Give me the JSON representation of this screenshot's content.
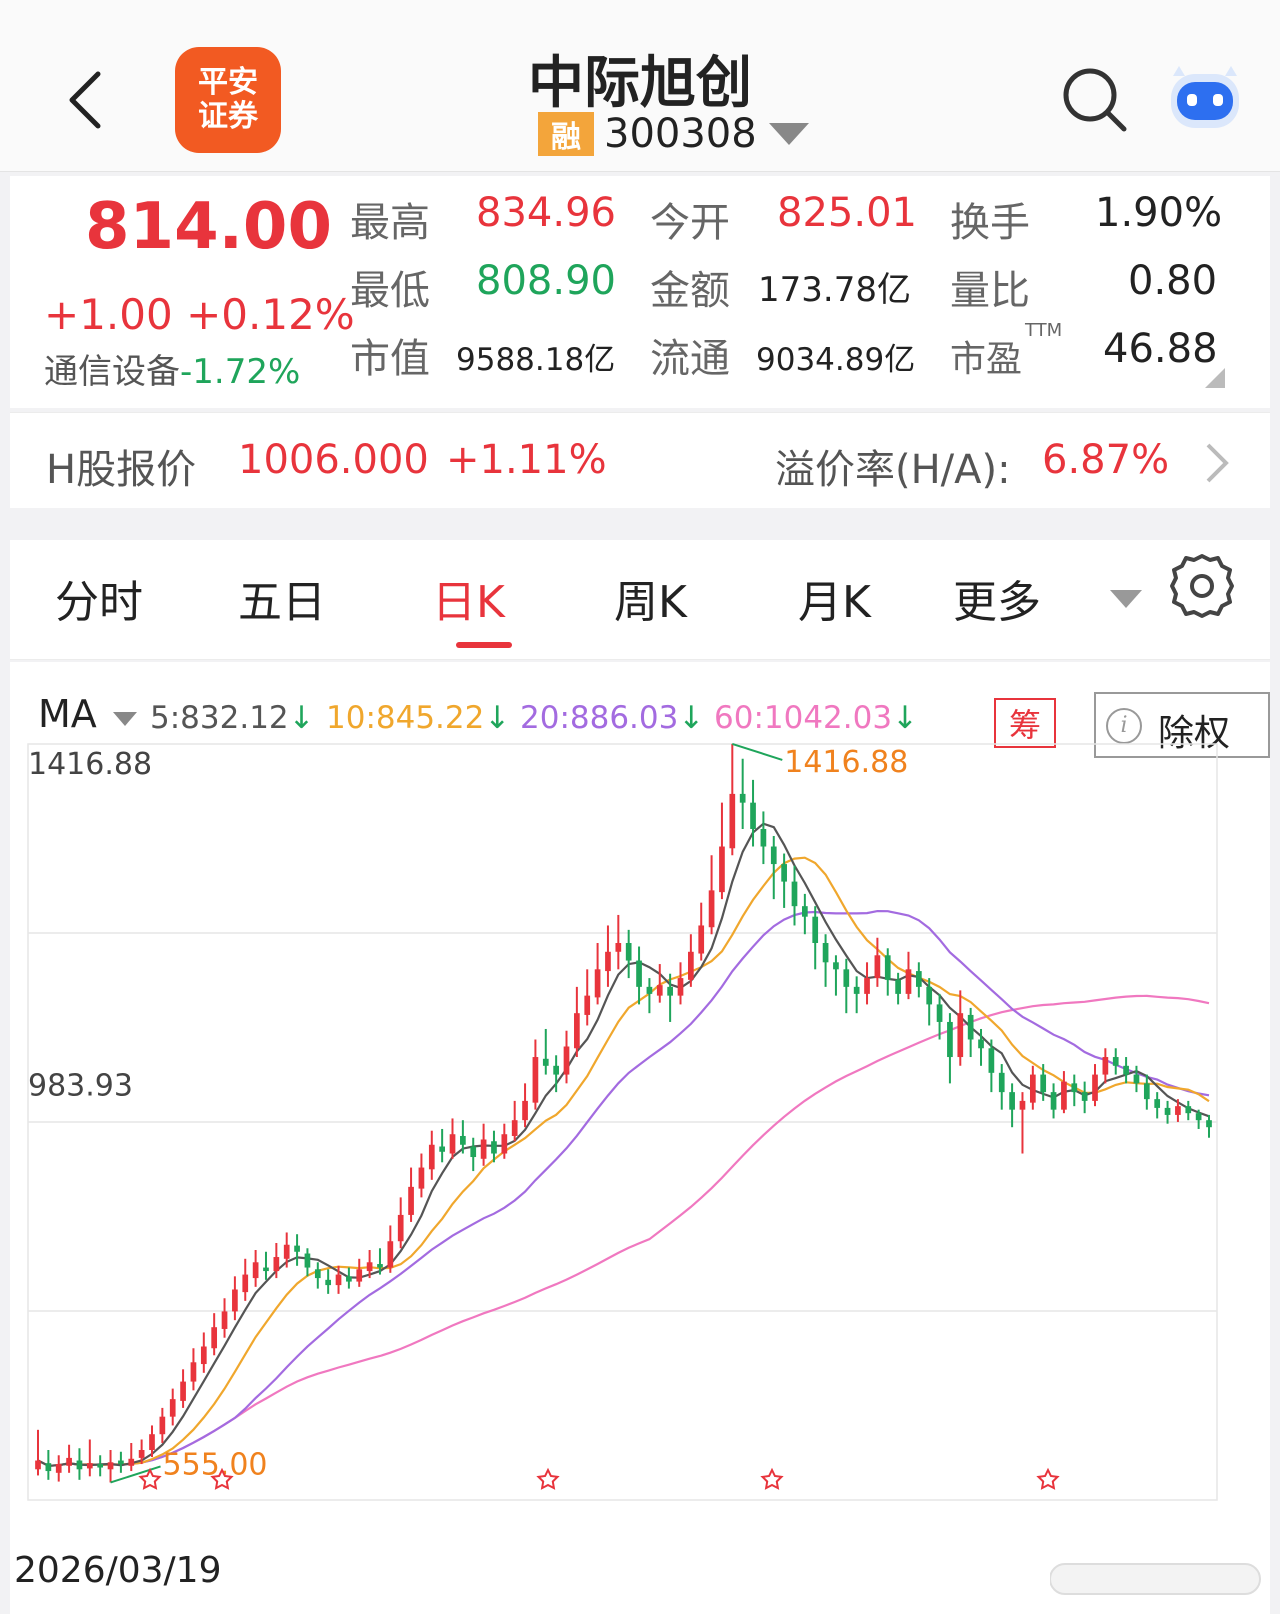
{
  "header": {
    "broker_logo_line1": "平安",
    "broker_logo_line2": "证券",
    "stock_name": "中际旭创",
    "margin_badge": "融",
    "stock_code": "300308"
  },
  "quote": {
    "price": "814.00",
    "change": "+1.00",
    "change_pct": "+0.12%",
    "industry_name": "通信设备",
    "industry_pct": "-1.72%",
    "high_label": "最高",
    "high": "834.96",
    "open_label": "今开",
    "open": "825.01",
    "turnover_label": "换手",
    "turnover": "1.90%",
    "low_label": "最低",
    "low": "808.90",
    "amount_label": "金额",
    "amount": "173.78亿",
    "vol_ratio_label": "量比",
    "vol_ratio": "0.80",
    "mcap_label": "市值",
    "mcap": "9588.18亿",
    "float_label": "流通",
    "float_mcap": "9034.89亿",
    "pe_label": "市盈",
    "pe_sup": "TTM",
    "pe": "46.88"
  },
  "h_share": {
    "label": "H股报价",
    "price": "1006.000",
    "pct": "+1.11%",
    "premium_label": "溢价率(H/A):",
    "premium": "6.87%"
  },
  "tabs": [
    "分时",
    "五日",
    "日K",
    "周K",
    "月K",
    "更多"
  ],
  "active_tab": "日K",
  "ma": {
    "label": "MA",
    "ma5": "5:832.12",
    "ma10": "10:845.22",
    "ma20": "20:886.03",
    "ma60": "60:1042.03",
    "chip_label": "筹",
    "ex_rights_label": "除权",
    "colors": {
      "ma5": "#555555",
      "ma10": "#f0a72d",
      "ma20": "#a36be0",
      "ma60": "#f078c0",
      "up": "#e8343c",
      "down": "#1fa55b"
    }
  },
  "chart_data": {
    "type": "candlestick",
    "y_labels": [
      "1416.88",
      "983.93"
    ],
    "max_marker": "1416.88",
    "min_marker": "555.00",
    "start_date": "2026/03/19",
    "ylim": [
      555,
      1416.88
    ],
    "candles": [
      [
        590,
        600,
        635,
        583
      ],
      [
        597,
        588,
        612,
        578
      ],
      [
        586,
        596,
        606,
        576
      ],
      [
        594,
        603,
        618,
        586
      ],
      [
        600,
        590,
        614,
        578
      ],
      [
        591,
        597,
        624,
        582
      ],
      [
        596,
        592,
        606,
        582
      ],
      [
        590,
        598,
        612,
        575
      ],
      [
        600,
        596,
        610,
        586
      ],
      [
        594,
        602,
        620,
        588
      ],
      [
        603,
        612,
        624,
        596
      ],
      [
        612,
        630,
        640,
        604
      ],
      [
        630,
        650,
        660,
        620
      ],
      [
        650,
        670,
        682,
        640
      ],
      [
        668,
        690,
        704,
        660
      ],
      [
        690,
        712,
        728,
        680
      ],
      [
        710,
        730,
        746,
        700
      ],
      [
        728,
        752,
        768,
        720
      ],
      [
        750,
        770,
        785,
        740
      ],
      [
        770,
        795,
        810,
        760
      ],
      [
        792,
        812,
        830,
        782
      ],
      [
        808,
        826,
        840,
        798
      ],
      [
        820,
        816,
        838,
        806
      ],
      [
        816,
        832,
        848,
        808
      ],
      [
        830,
        846,
        860,
        820
      ],
      [
        845,
        838,
        858,
        822
      ],
      [
        836,
        820,
        842,
        810
      ],
      [
        818,
        808,
        826,
        796
      ],
      [
        806,
        800,
        818,
        790
      ],
      [
        800,
        812,
        822,
        790
      ],
      [
        810,
        804,
        820,
        796
      ],
      [
        804,
        818,
        830,
        798
      ],
      [
        816,
        826,
        840,
        808
      ],
      [
        824,
        820,
        842,
        812
      ],
      [
        820,
        850,
        868,
        814
      ],
      [
        850,
        880,
        900,
        842
      ],
      [
        880,
        912,
        934,
        872
      ],
      [
        910,
        934,
        950,
        900
      ],
      [
        932,
        960,
        976,
        920
      ],
      [
        958,
        952,
        978,
        940
      ],
      [
        950,
        972,
        990,
        944
      ],
      [
        970,
        960,
        988,
        950
      ],
      [
        958,
        946,
        968,
        930
      ],
      [
        944,
        966,
        984,
        936
      ],
      [
        964,
        950,
        976,
        940
      ],
      [
        950,
        972,
        984,
        944
      ],
      [
        970,
        988,
        1010,
        964
      ],
      [
        988,
        1010,
        1030,
        980
      ],
      [
        1008,
        1060,
        1080,
        1000
      ],
      [
        1058,
        1050,
        1092,
        1040
      ],
      [
        1050,
        1040,
        1062,
        1020
      ],
      [
        1040,
        1072,
        1090,
        1030
      ],
      [
        1070,
        1110,
        1140,
        1060
      ],
      [
        1108,
        1130,
        1160,
        1096
      ],
      [
        1128,
        1160,
        1190,
        1120
      ],
      [
        1158,
        1180,
        1210,
        1140
      ],
      [
        1180,
        1190,
        1222,
        1160
      ],
      [
        1190,
        1170,
        1205,
        1150
      ],
      [
        1170,
        1140,
        1186,
        1120
      ],
      [
        1140,
        1132,
        1150,
        1110
      ],
      [
        1130,
        1142,
        1166,
        1122
      ],
      [
        1140,
        1130,
        1155,
        1100
      ],
      [
        1130,
        1150,
        1168,
        1120
      ],
      [
        1148,
        1180,
        1200,
        1140
      ],
      [
        1178,
        1210,
        1236,
        1170
      ],
      [
        1208,
        1250,
        1290,
        1200
      ],
      [
        1248,
        1300,
        1350,
        1240
      ],
      [
        1298,
        1360,
        1417,
        1290
      ],
      [
        1360,
        1350,
        1400,
        1320
      ],
      [
        1350,
        1320,
        1376,
        1300
      ],
      [
        1320,
        1300,
        1340,
        1280
      ],
      [
        1300,
        1280,
        1312,
        1240
      ],
      [
        1280,
        1260,
        1292,
        1230
      ],
      [
        1260,
        1232,
        1278,
        1210
      ],
      [
        1232,
        1220,
        1246,
        1200
      ],
      [
        1220,
        1190,
        1232,
        1160
      ],
      [
        1190,
        1168,
        1200,
        1140
      ],
      [
        1168,
        1160,
        1176,
        1130
      ],
      [
        1160,
        1140,
        1172,
        1110
      ],
      [
        1140,
        1132,
        1152,
        1110
      ],
      [
        1132,
        1150,
        1168,
        1120
      ],
      [
        1150,
        1176,
        1196,
        1140
      ],
      [
        1176,
        1148,
        1184,
        1130
      ],
      [
        1148,
        1132,
        1156,
        1120
      ],
      [
        1132,
        1160,
        1180,
        1126
      ],
      [
        1158,
        1140,
        1168,
        1128
      ],
      [
        1140,
        1120,
        1150,
        1096
      ],
      [
        1120,
        1100,
        1132,
        1080
      ],
      [
        1100,
        1060,
        1110,
        1030
      ],
      [
        1060,
        1110,
        1136,
        1050
      ],
      [
        1108,
        1080,
        1116,
        1060
      ],
      [
        1080,
        1070,
        1092,
        1050
      ],
      [
        1070,
        1042,
        1080,
        1020
      ],
      [
        1042,
        1020,
        1052,
        1000
      ],
      [
        1020,
        1000,
        1030,
        980
      ],
      [
        1000,
        1010,
        1020,
        950
      ],
      [
        1008,
        1040,
        1050,
        1000
      ],
      [
        1040,
        1020,
        1052,
        1010
      ],
      [
        1020,
        1000,
        1030,
        990
      ],
      [
        1000,
        1032,
        1044,
        996
      ],
      [
        1030,
        1020,
        1040,
        1004
      ],
      [
        1020,
        1010,
        1032,
        996
      ],
      [
        1010,
        1040,
        1052,
        1004
      ],
      [
        1040,
        1060,
        1070,
        1030
      ],
      [
        1060,
        1050,
        1070,
        1040
      ],
      [
        1050,
        1040,
        1060,
        1030
      ],
      [
        1040,
        1030,
        1050,
        1020
      ],
      [
        1030,
        1012,
        1040,
        1000
      ],
      [
        1012,
        1002,
        1020,
        990
      ],
      [
        1002,
        994,
        1010,
        984
      ],
      [
        994,
        1004,
        1012,
        986
      ],
      [
        1004,
        996,
        1010,
        988
      ],
      [
        996,
        988,
        1000,
        978
      ],
      [
        988,
        980,
        994,
        968
      ]
    ],
    "ma5": "dark grey line",
    "ma10": "orange line",
    "ma20": "purple line",
    "ma60": "pink line"
  }
}
